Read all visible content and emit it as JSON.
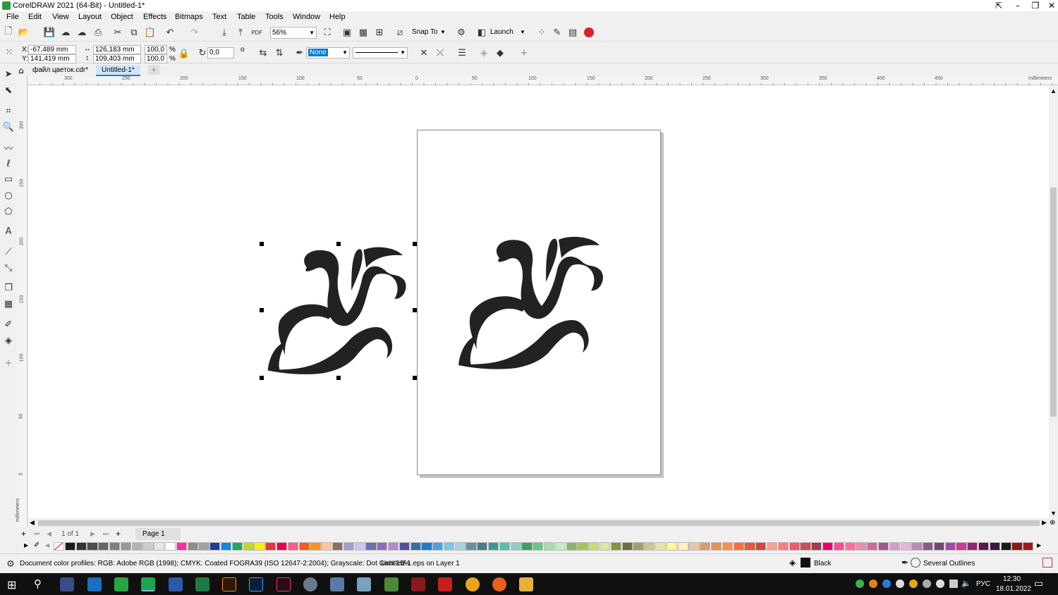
{
  "window": {
    "title": "CorelDRAW 2021 (64-Bit) - Untitled-1*"
  },
  "menu": [
    "File",
    "Edit",
    "View",
    "Layout",
    "Object",
    "Effects",
    "Bitmaps",
    "Text",
    "Table",
    "Tools",
    "Window",
    "Help"
  ],
  "toolbar": {
    "zoom": "56%",
    "snap_label": "Snap To",
    "launch_label": "Launch"
  },
  "props": {
    "x_label": "X:",
    "x": "-67,489 mm",
    "y_label": "Y:",
    "y": "141,419 mm",
    "w": "126,183 mm",
    "h": "109,403 mm",
    "sx": "100,0",
    "sy": "100,0",
    "pct": "%",
    "rotation": "0,0",
    "deg": "o",
    "fill": "None"
  },
  "tabs": [
    {
      "label": "файл цветок.cdr*"
    },
    {
      "label": "Untitled-1*"
    }
  ],
  "rulers": {
    "h_ticks": [
      "300",
      "250",
      "200",
      "150",
      "100",
      "50",
      "0",
      "50",
      "100",
      "150",
      "200",
      "250",
      "300",
      "350",
      "400",
      "450"
    ],
    "h_unit": "millimeters",
    "v_ticks": [
      "300",
      "250",
      "200",
      "150",
      "100",
      "50",
      "0"
    ],
    "v_unit": "millimeters"
  },
  "pagenav": {
    "count": "1 of 1",
    "page_tab": "Page 1"
  },
  "palette": [
    "#ffffff",
    "#1a1a1a",
    "#333333",
    "#4d4d4d",
    "#666666",
    "#808080",
    "#999999",
    "#b3b3b3",
    "#cccccc",
    "#e6e6e6",
    "#ffffff",
    "#ff2ea0",
    "#8c8c8c",
    "#a0a0a0",
    "#1f3c99",
    "#0a8ed9",
    "#1aab5f",
    "#bdd630",
    "#fff200",
    "#e03a3a",
    "#e8004f",
    "#ff5c8a",
    "#f15a24",
    "#f7941d",
    "#ffc1a0",
    "#8b6f5c",
    "#a0a0c8",
    "#c8c8e8",
    "#6e6eb0",
    "#8c6eb8",
    "#b08ccf",
    "#5050a0",
    "#3c6ea0",
    "#1f7cc4",
    "#4aa0e0",
    "#80c4e8",
    "#a8d0e0",
    "#6e8ca0",
    "#4c7a8c",
    "#3c9a8c",
    "#5abcaa",
    "#8cd0c0",
    "#3ca06e",
    "#6ec08c",
    "#a8dca8",
    "#c8e8c8",
    "#8cb46e",
    "#a0c850",
    "#c8dc78",
    "#dce8a0",
    "#7e9a3c",
    "#6e6e3c",
    "#a0a06e",
    "#c8c88c",
    "#e6e6a0",
    "#fff88c",
    "#fff0c0",
    "#e8c8a0",
    "#d2a070",
    "#e0945a",
    "#ff8c50",
    "#ff6e3c",
    "#e05a3c",
    "#c84c3c",
    "#ffa08c",
    "#ff7c7c",
    "#e85c6e",
    "#c84c5c",
    "#a03c4c",
    "#e8006e",
    "#ff4c8c",
    "#ff6e9a",
    "#e88cb4",
    "#c86ea0",
    "#a05a8c",
    "#d2a0c8",
    "#e8b4d8",
    "#b48cb4",
    "#8c5a8c",
    "#6e4c6e",
    "#a04ca0",
    "#c83ca0",
    "#8c2a6e",
    "#5a1a4a",
    "#3c1a3c",
    "#1a1a1a",
    "#8c1a1a",
    "#a01a1a"
  ],
  "status": {
    "profiles": "Document color profiles: RGB: Adobe RGB (1998); CMYK: Coated FOGRA39 (ISO 12647-2:2004); Grayscale: Dot Gain 15%",
    "object": "Untitled-1.eps on Layer 1",
    "fill": "Black",
    "outline": "Several Outlines"
  },
  "taskbar": {
    "lang": "РУС",
    "time": "12:30",
    "date": "18.01.2022"
  }
}
